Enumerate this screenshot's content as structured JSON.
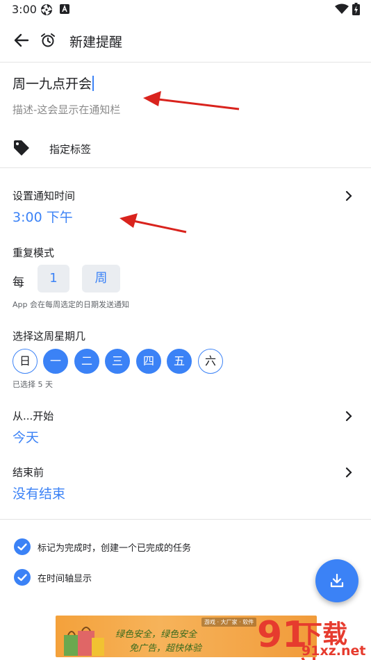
{
  "status_bar": {
    "time": "3:00"
  },
  "appbar": {
    "title": "新建提醒"
  },
  "form": {
    "title_value": "周一九点开会",
    "description_placeholder": "描述-这会显示在通知栏",
    "tag_label": "指定标签"
  },
  "notify_time": {
    "label": "设置通知时间",
    "value": "3:00 下午"
  },
  "repeat": {
    "label": "重复模式",
    "every_label": "每",
    "interval": "1",
    "unit": "周",
    "hint": "App 会在每周选定的日期发送通知"
  },
  "weekdays": {
    "label": "选择这周星期几",
    "days": [
      {
        "label": "日",
        "selected": false
      },
      {
        "label": "一",
        "selected": true
      },
      {
        "label": "二",
        "selected": true
      },
      {
        "label": "三",
        "selected": true
      },
      {
        "label": "四",
        "selected": true
      },
      {
        "label": "五",
        "selected": true
      },
      {
        "label": "六",
        "selected": false
      }
    ],
    "selected_summary": "已选择 5 天"
  },
  "start": {
    "label": "从...开始",
    "value": "今天"
  },
  "end": {
    "label": "结束前",
    "value": "没有结束"
  },
  "options": [
    {
      "label": "标记为完成时，创建一个已完成的任务",
      "checked": true
    },
    {
      "label": "在时间轴显示",
      "checked": true
    }
  ],
  "banner": {
    "line1": "绿色安全，绿色安全",
    "line2": "免广告，超快体验",
    "tag": "游戏 · 大厂家 · 软件"
  },
  "watermark": {
    "number": "91",
    "main": "下载站",
    "sub": "91xz.net"
  },
  "colors": {
    "accent": "#3b82f6",
    "annotation_arrow": "#d9231d"
  }
}
